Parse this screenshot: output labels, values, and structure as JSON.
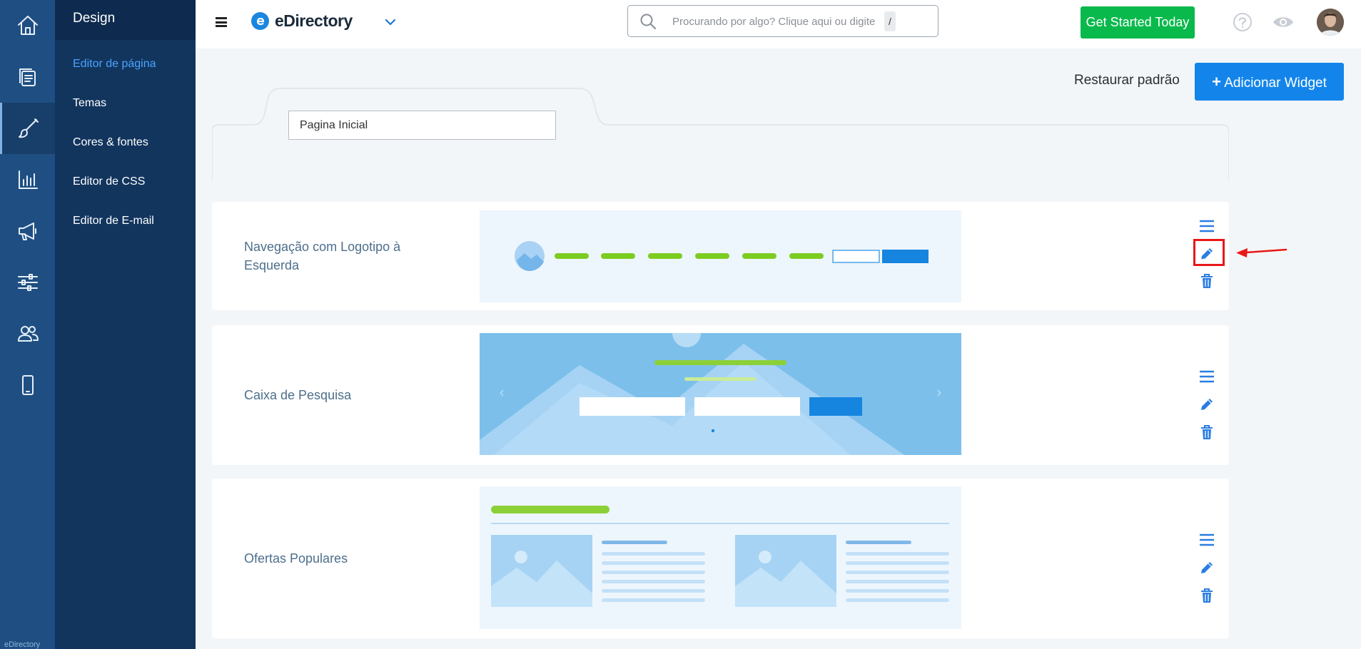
{
  "sidebar": {
    "section_title": "Design",
    "items": [
      {
        "label": "Editor de página",
        "active": true
      },
      {
        "label": "Temas",
        "active": false
      },
      {
        "label": "Cores & fontes",
        "active": false
      },
      {
        "label": "Editor de CSS",
        "active": false
      },
      {
        "label": "Editor de E-mail",
        "active": false
      }
    ],
    "rail_icons": [
      "home-icon",
      "pages-icon",
      "brush-icon",
      "chart-icon",
      "megaphone-icon",
      "sliders-icon",
      "users-icon",
      "mobile-icon"
    ],
    "footer_brand": "eDirectory"
  },
  "topbar": {
    "logo_text": "eDirectory",
    "search_placeholder": "Procurando por algo? Clique aqui ou digite",
    "search_shortcut": "/",
    "cta_label": "Get Started Today",
    "icons": [
      "menu-icon",
      "chevron-down-icon",
      "search-icon",
      "help-icon",
      "eye-icon",
      "avatar"
    ]
  },
  "toolbar": {
    "restore_label": "Restaurar padrão",
    "add_widget_label": "Adicionar Widget"
  },
  "page_selector": {
    "value": "Pagina Inicial"
  },
  "widgets": [
    {
      "label": "Navegação com Logotipo à Esquerda",
      "highlight_edit": true
    },
    {
      "label": "Caixa de Pesquisa",
      "highlight_edit": false
    },
    {
      "label": "Ofertas Populares",
      "highlight_edit": false
    }
  ],
  "colors": {
    "rail_bg": "#1f4f82",
    "subnav_bg": "#12355e",
    "accent_blue": "#1385ea",
    "cta_green": "#09b94c",
    "highlight_red": "#e81818"
  }
}
